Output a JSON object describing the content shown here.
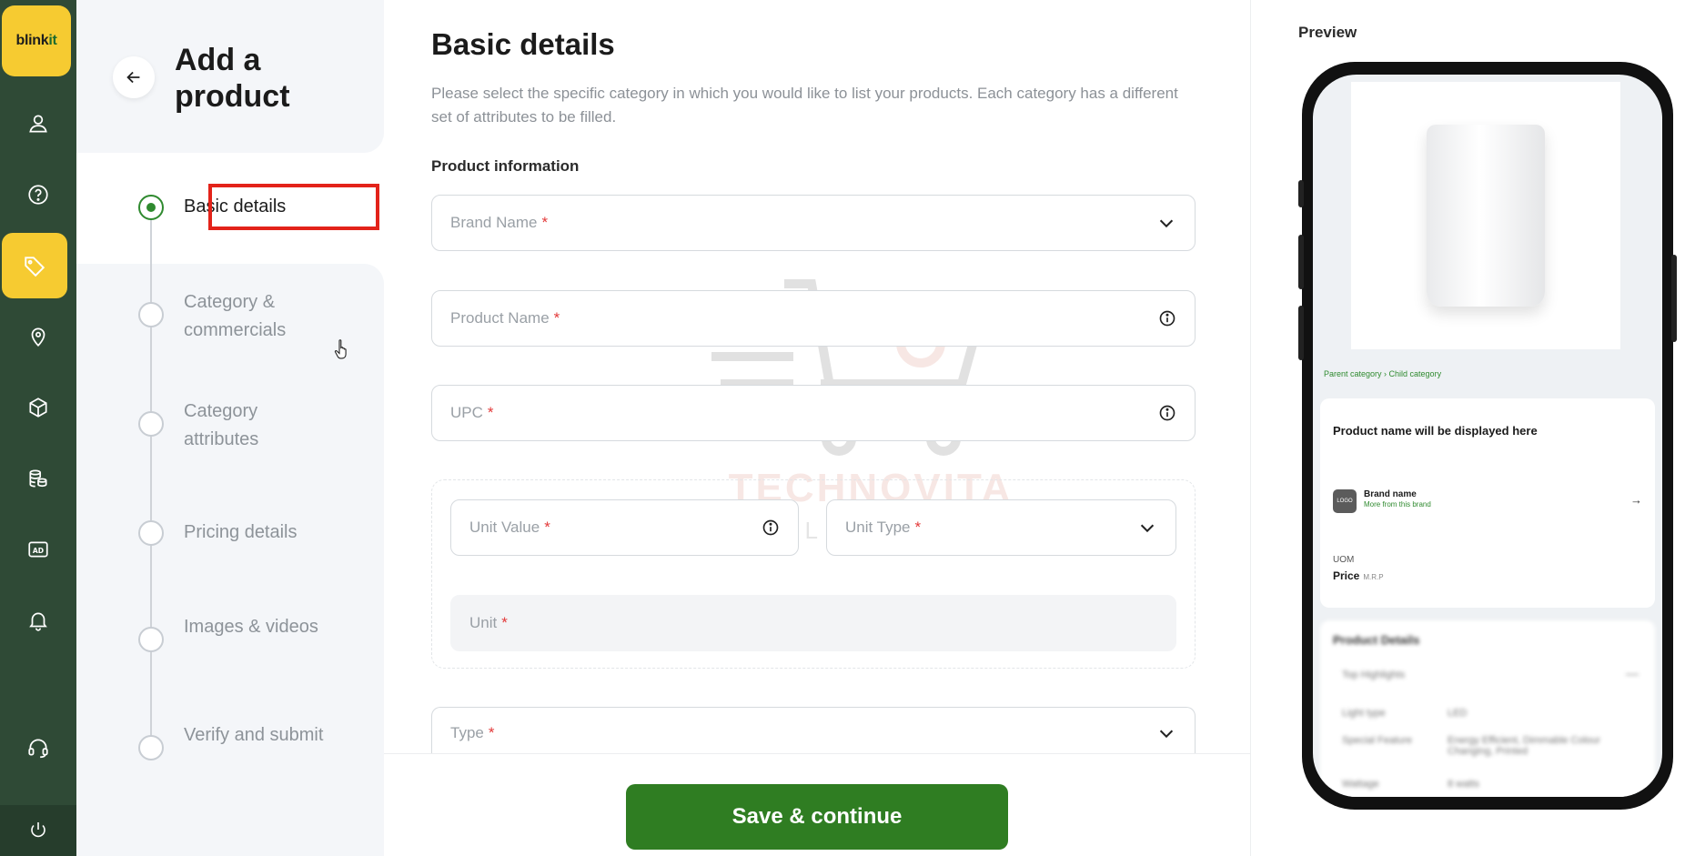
{
  "app": {
    "logo_text_main": "blink",
    "logo_text_accent": "it"
  },
  "rail": {
    "items": [
      {
        "name": "profile",
        "icon": "user-icon"
      },
      {
        "name": "help",
        "icon": "question-icon"
      },
      {
        "name": "products",
        "icon": "tag-icon",
        "active": true
      },
      {
        "name": "locations",
        "icon": "location-pin-icon"
      },
      {
        "name": "inventory",
        "icon": "box-icon"
      },
      {
        "name": "payments",
        "icon": "coins-icon"
      },
      {
        "name": "ads",
        "icon": "ad-icon"
      },
      {
        "name": "notifications",
        "icon": "bell-icon"
      },
      {
        "name": "support",
        "icon": "headset-icon"
      },
      {
        "name": "logout",
        "icon": "power-icon"
      }
    ],
    "accent": "#f6cb31",
    "background": "#2f4a36"
  },
  "header": {
    "title": "Add a product"
  },
  "steps": [
    {
      "label": "Basic details",
      "active": true
    },
    {
      "label": "Category & commercials"
    },
    {
      "label": "Category attributes"
    },
    {
      "label": "Pricing details"
    },
    {
      "label": "Images & videos"
    },
    {
      "label": "Verify and submit"
    }
  ],
  "form": {
    "title": "Basic details",
    "description": "Please select the specific category in which you would like to list your products. Each category has a different set of attributes to be filled.",
    "section_label": "Product information",
    "fields": {
      "brand_name": "Brand Name",
      "product_name": "Product Name",
      "upc": "UPC",
      "unit_value": "Unit Value",
      "unit_type": "Unit Type",
      "unit": "Unit",
      "type": "Type"
    },
    "required_mark": "*",
    "save_button": "Save & continue",
    "primary_color": "#2f7d22"
  },
  "watermark": {
    "line1": "TECHNOVITA",
    "line2": "SOLUTIONS"
  },
  "preview": {
    "label": "Preview",
    "breadcrumb": "Parent category › Child category",
    "product_name": "Product name will be displayed here",
    "brand_logo": "LOGO",
    "brand_name": "Brand name",
    "brand_sub": "More from this brand",
    "uom": "UOM",
    "price": "Price",
    "mrp": "M.R.P",
    "details_title": "Product Details",
    "highlights": "Top Highlights",
    "rows": [
      {
        "key": "Light type",
        "value": "LED"
      },
      {
        "key": "Special Feature",
        "value": "Energy Efficient, Dimmable Colour Changing, Printed"
      },
      {
        "key": "Wattage",
        "value": "8 watts"
      }
    ]
  }
}
